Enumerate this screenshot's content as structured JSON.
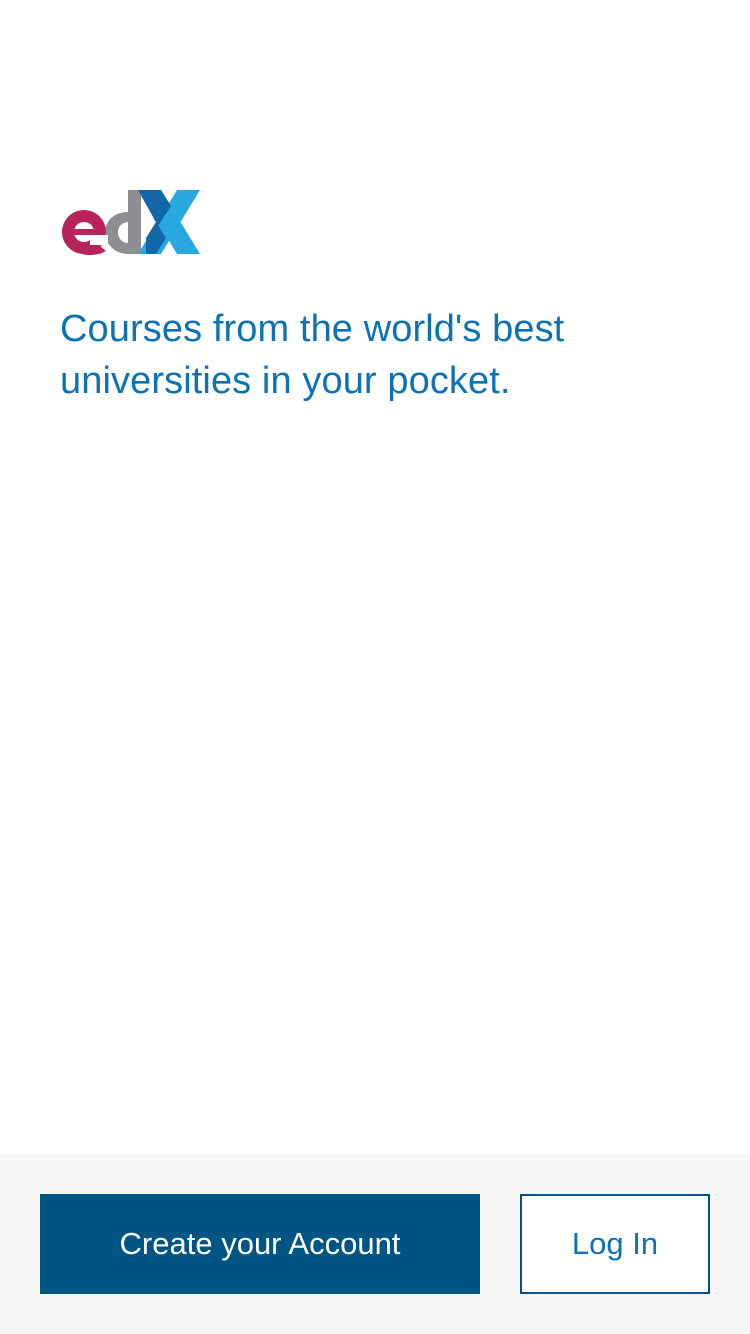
{
  "logo": {
    "text": "edX",
    "colors": {
      "e": "#b5245b",
      "d": "#8d8f92",
      "x_light": "#29a8e0",
      "x_dark": "#1267a9"
    }
  },
  "tagline": "Courses from the world's best universities in your pocket.",
  "actions": {
    "create_account": "Create your Account",
    "log_in": "Log In"
  },
  "theme": {
    "brand_blue": "#005585",
    "link_blue": "#0b73b5",
    "footer_bg": "#f7f7f7"
  }
}
